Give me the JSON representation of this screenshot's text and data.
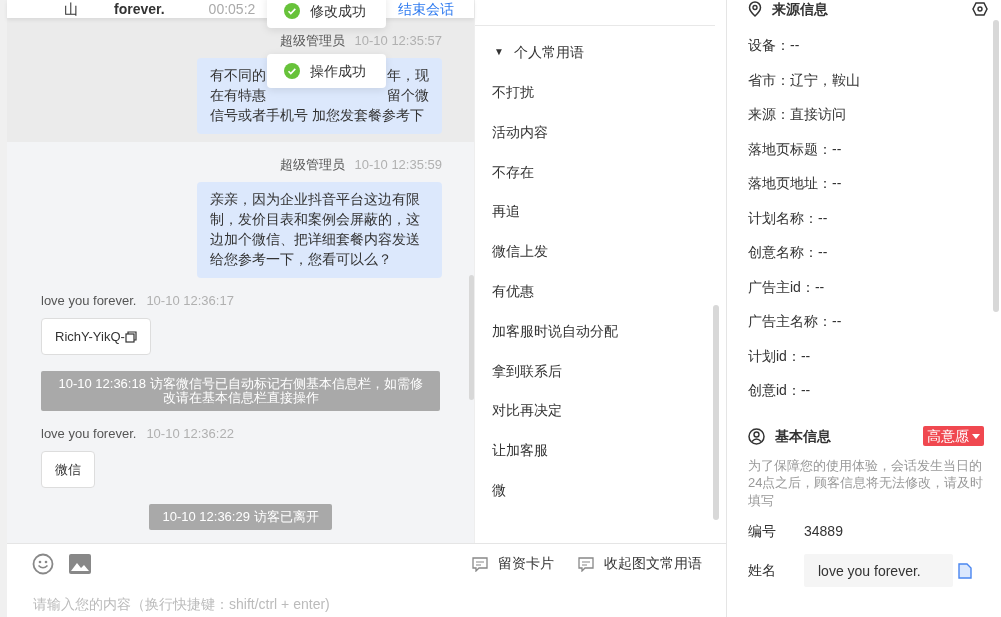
{
  "header": {
    "visitor_region": "山",
    "visitor_name": "forever.",
    "duration": "00:05:2",
    "end_button": "结束会话"
  },
  "toasts": [
    {
      "text": "修改成功"
    },
    {
      "text": "操作成功"
    }
  ],
  "messages": [
    {
      "kind": "agent",
      "sender": "超级管理员",
      "time": "10-10 12:35:57",
      "highlighted": true,
      "lines": [
        {
          "left": "有不同的",
          "right": "年，现"
        },
        {
          "left": "在有特惠",
          "right": "留个微"
        },
        {
          "left": "信号或者手机号 加您发套餐参考下"
        }
      ]
    },
    {
      "kind": "agent",
      "sender": "超级管理员",
      "time": "10-10 12:35:59",
      "highlighted": false,
      "text": "亲亲，因为企业抖音平台这边有限制，发价目表和案例会屏蔽的，这边加个微信、把详细套餐内容发送给您参考一下，您看可以么？"
    },
    {
      "kind": "visitor",
      "sender": "love you forever.",
      "time": "10-10 12:36:17",
      "text": "RichY-YikQ-",
      "copyable": true
    },
    {
      "kind": "system",
      "text": "10-10 12:36:18 访客微信号已自动标记右侧基本信息栏，如需修改请在基本信息栏直接操作"
    },
    {
      "kind": "visitor",
      "sender": "love you forever.",
      "time": "10-10 12:36:22",
      "text": "微信",
      "copyable": false
    },
    {
      "kind": "system",
      "text": "10-10 12:36:29 访客已离开"
    }
  ],
  "composer": {
    "placeholder": "请输入您的内容（换行快捷键：shift/ctrl + enter)",
    "actions": [
      "留资卡片",
      "收起图文常用语"
    ]
  },
  "phrases": {
    "group": "个人常用语",
    "toggle_glyph": "▼",
    "expanded": true,
    "items": [
      "不打扰",
      "活动内容",
      "不存在",
      "再追",
      "微信上发",
      "有优惠",
      "加客服时说自动分配",
      "拿到联系后",
      "对比再决定",
      "让加客服",
      "微"
    ]
  },
  "source_info": {
    "title": "来源信息",
    "fields": [
      "设备：--",
      "省市：辽宁，鞍山",
      "来源：直接访问",
      "落地页标题：--",
      "落地页地址：--",
      "计划名称：--",
      "创意名称：--",
      "广告主id：--",
      "广告主名称：--",
      "计划id：--",
      "创意id：--"
    ]
  },
  "basic_info": {
    "title": "基本信息",
    "intent": "高意愿",
    "note": "为了保障您的使用体验，会话发生当日的24点之后，顾客信息将无法修改，请及时填写",
    "fields": [
      {
        "kind": "text",
        "label": "编号",
        "value": "34889"
      },
      {
        "kind": "input",
        "label": "姓名",
        "value": "love you forever."
      }
    ]
  }
}
